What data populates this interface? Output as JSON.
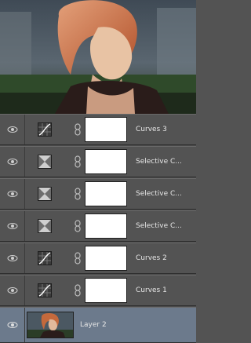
{
  "layers": [
    {
      "name": "Curves 3",
      "kind": "curves",
      "icon": "curves-adjustment-icon",
      "selected": false
    },
    {
      "name": "Selective C...",
      "kind": "selective-color",
      "icon": "selective-color-adjustment-icon",
      "selected": false
    },
    {
      "name": "Selective C...",
      "kind": "selective-color",
      "icon": "selective-color-adjustment-icon",
      "selected": false
    },
    {
      "name": "Selective C...",
      "kind": "selective-color",
      "icon": "selective-color-adjustment-icon",
      "selected": false
    },
    {
      "name": "Curves 2",
      "kind": "curves",
      "icon": "curves-adjustment-icon",
      "selected": false
    },
    {
      "name": "Curves 1",
      "kind": "curves",
      "icon": "curves-adjustment-icon",
      "selected": false
    },
    {
      "name": "Layer 2",
      "kind": "pixel",
      "icon": "layer-thumbnail",
      "selected": true
    }
  ],
  "colors": {
    "panel_bg": "#535353",
    "selected_row": "#6c7a8c",
    "mask_white": "#ffffff"
  }
}
